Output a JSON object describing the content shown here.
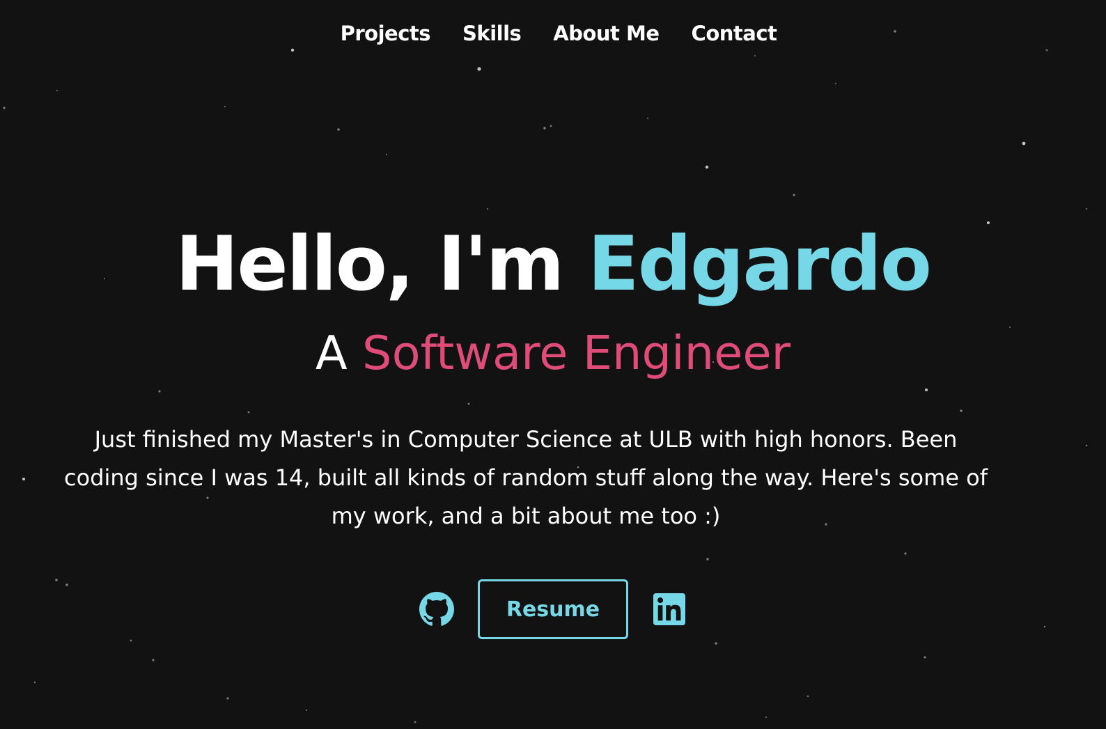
{
  "nav": {
    "items": [
      {
        "label": "Projects"
      },
      {
        "label": "Skills"
      },
      {
        "label": "About Me"
      },
      {
        "label": "Contact"
      }
    ]
  },
  "hero": {
    "greeting": "Hello, I'm ",
    "name": "Edgardo",
    "subtitle_prefix": "A ",
    "subtitle_role": "Software Engineer",
    "intro": "Just finished my Master's in Computer Science at ULB with high honors. Been coding since I was 14, built all kinds of random stuff along the way. Here's some of my work, and a bit about me too :)"
  },
  "actions": {
    "github_icon": "github-icon",
    "resume_label": "Resume",
    "linkedin_icon": "linkedin-icon"
  },
  "colors": {
    "background": "#121212",
    "accent": "#76d7e6",
    "role_accent": "#e04c78",
    "text": "#ffffff"
  }
}
